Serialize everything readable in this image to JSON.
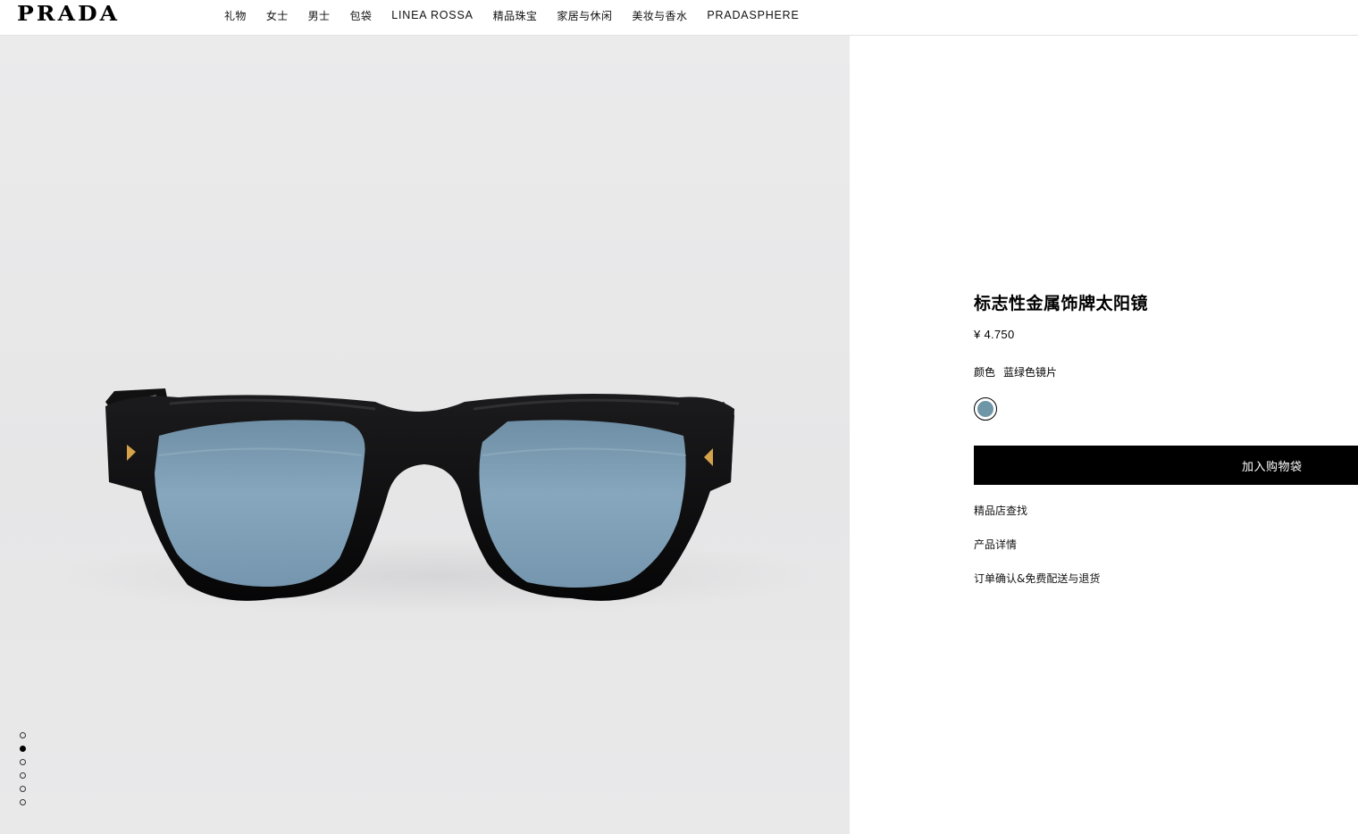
{
  "header": {
    "logo": "PRADA",
    "nav": [
      {
        "label": "礼物"
      },
      {
        "label": "女士"
      },
      {
        "label": "男士"
      },
      {
        "label": "包袋"
      },
      {
        "label": "LINEA ROSSA"
      },
      {
        "label": "精品珠宝"
      },
      {
        "label": "家居与休闲"
      },
      {
        "label": "美妆与香水"
      },
      {
        "label": "PRADASPHERE"
      }
    ]
  },
  "gallery": {
    "image_subject": "black-sunglasses-blue-lenses",
    "slide_count": 6,
    "active_slide": 2
  },
  "product": {
    "title": "标志性金属饰牌太阳镜",
    "price": "¥ 4.750",
    "color_label": "颜色",
    "color_value": "蓝绿色镜片",
    "swatch_color": "#6f96a6",
    "add_to_bag": "加入购物袋",
    "links": {
      "store_finder": "精品店查找",
      "details": "产品详情",
      "shipping": "订单确认&免费配送与退货"
    }
  },
  "colors": {
    "frame": "#0c0c0d",
    "lens": "#7d9fb6",
    "accent_gold": "#d6a24a"
  }
}
